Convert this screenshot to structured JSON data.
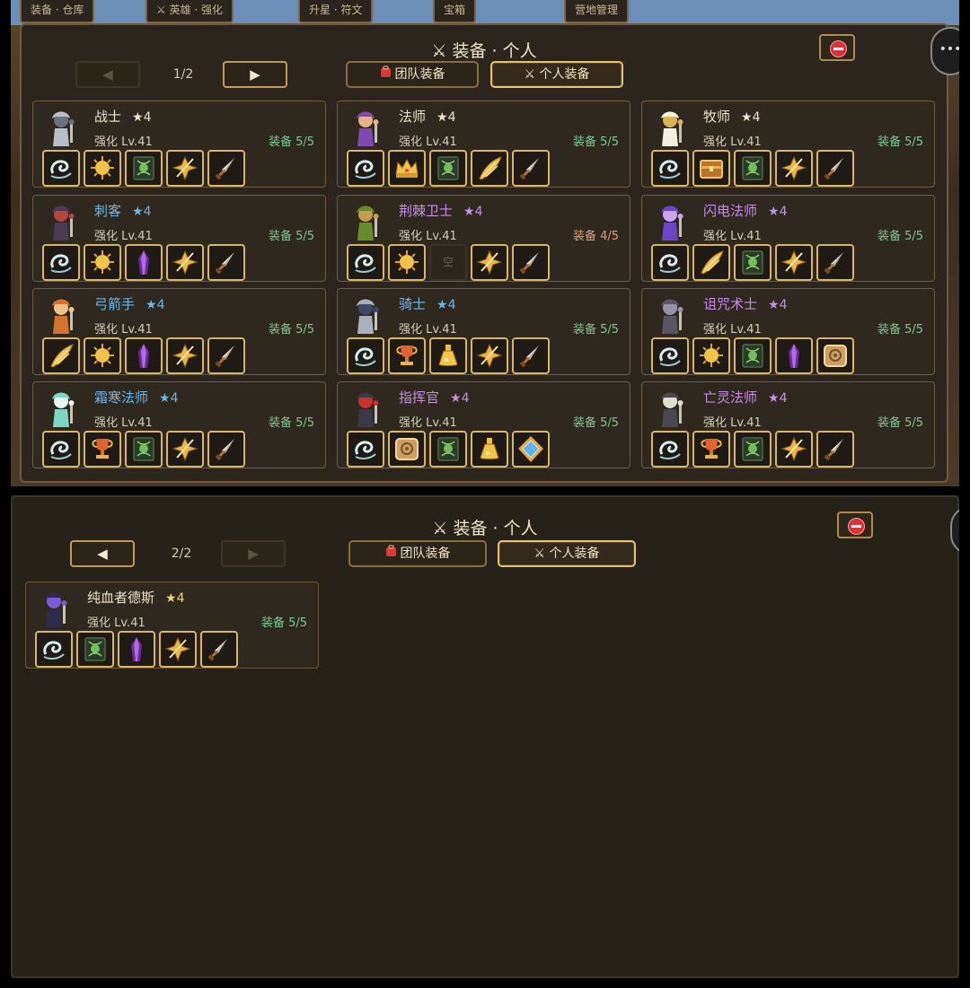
{
  "top_tabs": [
    "装备 · 仓库",
    "⚔ 英雄 · 强化",
    "升星 · 符文",
    "宝箱",
    "营地管理"
  ],
  "page1": {
    "title": "⚔ 装备 · 个人",
    "page_indicator": "1/2",
    "prev_arrow": "◀",
    "next_arrow": "▶",
    "tab_team": "团队装备",
    "tab_personal": "⚔ 个人装备",
    "edge_glyph": "•••",
    "heroes": [
      {
        "name": "战士",
        "stars": "★4",
        "name_color": "white",
        "level": "强化 Lv.41",
        "equip": "装备 5/5",
        "portrait": "knight-silver-icon",
        "slots": [
          "swirl",
          "sun",
          "tome",
          "gold-rune",
          "dagger"
        ]
      },
      {
        "name": "法师",
        "stars": "★4",
        "name_color": "white",
        "level": "强化 Lv.41",
        "equip": "装备 5/5",
        "portrait": "witch-icon",
        "slots": [
          "swirl",
          "crown",
          "tome",
          "wing",
          "dagger"
        ]
      },
      {
        "name": "牧师",
        "stars": "★4",
        "name_color": "white",
        "level": "强化 Lv.41",
        "equip": "装备 5/5",
        "portrait": "priest-icon",
        "slots": [
          "swirl",
          "chest",
          "tome",
          "gold-rune",
          "dagger"
        ]
      },
      {
        "name": "刺客",
        "stars": "★4",
        "name_color": "blue",
        "level": "强化 Lv.41",
        "equip": "装备 5/5",
        "portrait": "assassin-icon",
        "slots": [
          "swirl",
          "sun",
          "crystal",
          "gold-rune",
          "dagger"
        ]
      },
      {
        "name": "荆棘卫士",
        "stars": "★4",
        "name_color": "purple",
        "level": "强化 Lv.41",
        "equip": "装备 4/5",
        "portrait": "goblin-icon",
        "slots": [
          "swirl",
          "sun",
          "empty",
          "gold-rune",
          "dagger"
        ]
      },
      {
        "name": "闪电法师",
        "stars": "★4",
        "name_color": "purple",
        "level": "强化 Lv.41",
        "equip": "装备 5/5",
        "portrait": "sorcerer-icon",
        "slots": [
          "swirl",
          "wing",
          "tome",
          "gold-rune",
          "dagger"
        ]
      },
      {
        "name": "弓箭手",
        "stars": "★4",
        "name_color": "blue",
        "level": "强化 Lv.41",
        "equip": "装备 5/5",
        "portrait": "archer-icon",
        "slots": [
          "wing",
          "sun",
          "crystal",
          "gold-rune",
          "dagger"
        ]
      },
      {
        "name": "骑士",
        "stars": "★4",
        "name_color": "blue",
        "level": "强化 Lv.41",
        "equip": "装备 5/5",
        "portrait": "paladin-icon",
        "slots": [
          "swirl",
          "trophy",
          "flask",
          "gold-rune",
          "dagger"
        ]
      },
      {
        "name": "诅咒术士",
        "stars": "★4",
        "name_color": "purple",
        "level": "强化 Lv.41",
        "equip": "装备 5/5",
        "portrait": "warlock-icon",
        "slots": [
          "swirl",
          "sun",
          "tome",
          "crystal",
          "shield-emblem"
        ]
      },
      {
        "name": "霜寒法师",
        "stars": "★4",
        "name_color": "blue",
        "level": "强化 Lv.41",
        "equip": "装备 5/5",
        "portrait": "frost-mage-icon",
        "slots": [
          "swirl",
          "trophy",
          "tome",
          "gold-rune",
          "dagger"
        ]
      },
      {
        "name": "指挥官",
        "stars": "★4",
        "name_color": "purple",
        "level": "强化 Lv.41",
        "equip": "装备 5/5",
        "portrait": "commander-icon",
        "slots": [
          "swirl",
          "shield-emblem",
          "tome",
          "flask",
          "gem"
        ]
      },
      {
        "name": "亡灵法师",
        "stars": "★4",
        "name_color": "purple",
        "level": "强化 Lv.41",
        "equip": "装备 5/5",
        "portrait": "necromancer-icon",
        "slots": [
          "swirl",
          "trophy",
          "tome",
          "gold-rune",
          "dagger"
        ]
      }
    ]
  },
  "page2": {
    "title": "⚔ 装备 · 个人",
    "page_indicator": "2/2",
    "prev_arrow": "◀",
    "next_arrow": "▶",
    "tab_team": "团队装备",
    "tab_personal": "⚔ 个人装备",
    "heroes": [
      {
        "name": "纯血者德斯",
        "stars": "★4",
        "name_color": "white",
        "level": "强化 Lv.41",
        "equip": "装备 5/5",
        "portrait": "dark-knight-icon",
        "slots": [
          "swirl",
          "tome",
          "crystal",
          "gold-rune",
          "dagger"
        ]
      }
    ]
  },
  "colors": {
    "gold_border": "#d7b56a",
    "equip_full": "#7fc78f",
    "equip_partial": "#e0a070",
    "name_blue": "#6fb6e8",
    "name_purple": "#c68ee6",
    "close_red": "#d9333a"
  },
  "empty_slot_label": "空"
}
